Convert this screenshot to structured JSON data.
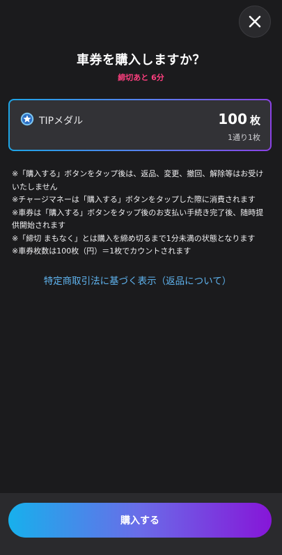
{
  "header": {
    "title": "車券を購入しますか？",
    "deadline": "締切あと 6分",
    "close_icon": "close-icon"
  },
  "ticket": {
    "icon": "star-medal-icon",
    "name": "TIPメダル",
    "count": "100",
    "count_unit": "枚",
    "rate": "1通り1枚"
  },
  "notes": [
    "※「購入する」ボタンをタップ後は、返品、変更、撤回、解除等はお受けいたしません",
    "※チャージマネーは「購入する」ボタンをタップした際に消費されます",
    "※車券は「購入する」ボタンをタップ後のお支払い手続き完了後、随時提供開始されます",
    "※「締切 まもなく」とは購入を締め切るまで1分未満の状態となります",
    "※車券枚数は100枚（円）＝1枚でカウントされます"
  ],
  "legal_link": "特定商取引法に基づく表示（返品について）",
  "purchase_button": "購入する",
  "colors": {
    "background": "#1b1b1d",
    "deadline": "#ff3f7f",
    "link": "#5fb3ee",
    "gradient_start": "#17b0ec",
    "gradient_end": "#8616d8"
  }
}
